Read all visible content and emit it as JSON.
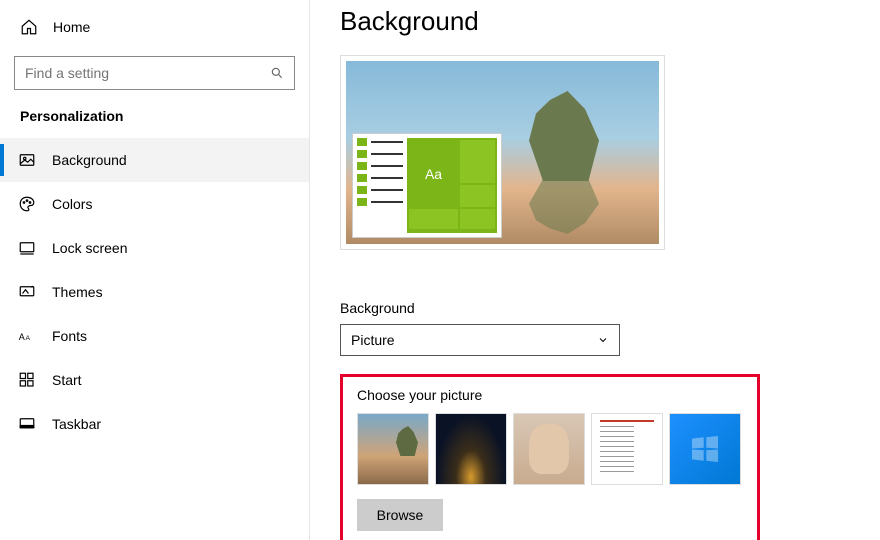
{
  "home_label": "Home",
  "search_placeholder": "Find a setting",
  "category": "Personalization",
  "nav": [
    {
      "label": "Background"
    },
    {
      "label": "Colors"
    },
    {
      "label": "Lock screen"
    },
    {
      "label": "Themes"
    },
    {
      "label": "Fonts"
    },
    {
      "label": "Start"
    },
    {
      "label": "Taskbar"
    }
  ],
  "page_title": "Background",
  "preview_sample_text": "Aa",
  "bg_label": "Background",
  "bg_value": "Picture",
  "choose_label": "Choose your picture",
  "browse_label": "Browse",
  "accent_color": "#0078d4"
}
